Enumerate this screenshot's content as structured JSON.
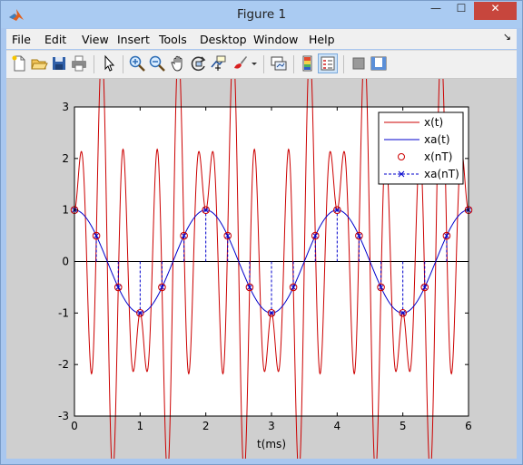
{
  "window": {
    "title": "Figure 1",
    "minimize_symbol": "—",
    "maximize_symbol": "☐",
    "close_symbol": "✕"
  },
  "menubar": {
    "items": [
      "File",
      "Edit",
      "View",
      "Insert",
      "Tools",
      "Desktop",
      "Window",
      "Help"
    ],
    "dock_symbol": "↘"
  },
  "toolbar": {
    "buttons": [
      "new-figure-icon",
      "open-file-icon",
      "save-icon",
      "print-icon",
      "edit-plot-arrow-icon",
      "zoom-in-icon",
      "zoom-out-icon",
      "pan-hand-icon",
      "rotate-3d-icon",
      "data-cursor-icon",
      "brush-icon",
      "brush-dropdown-icon",
      "link-plot-icon",
      "insert-colorbar-icon",
      "insert-legend-icon",
      "hide-plot-tools-icon",
      "show-plot-tools-icon"
    ]
  },
  "chart_data": {
    "type": "line",
    "title": "",
    "xlabel": "t(ms)",
    "ylabel": "",
    "xlim": [
      0,
      6
    ],
    "ylim": [
      -3,
      3
    ],
    "xticks": [
      0,
      1,
      2,
      3,
      4,
      5,
      6
    ],
    "yticks": [
      -3,
      -2,
      -1,
      0,
      1,
      2,
      3
    ],
    "grid": false,
    "legend_position": "top-right",
    "series": [
      {
        "name": "x(t)",
        "color": "#cc0000",
        "style": "solid",
        "formula": "cos(2*pi*0.5*t) + 2*cos(2*pi*2.5*t) - 2*cos(2*pi*3.5*t)"
      },
      {
        "name": "xa(t)",
        "color": "#0000cc",
        "style": "solid",
        "formula": "cos(2*pi*0.5*t)"
      },
      {
        "name": "x(nT)",
        "color": "#cc0000",
        "style": "circle-markers",
        "x": [
          0,
          0.333,
          0.667,
          1,
          1.333,
          1.667,
          2,
          2.333,
          2.667,
          3,
          3.333,
          3.667,
          4,
          4.333,
          4.667,
          5,
          5.333,
          5.667,
          6
        ],
        "y": [
          1,
          0.5,
          -0.5,
          -1,
          -0.5,
          0.5,
          1,
          0.5,
          -0.5,
          -1,
          -0.5,
          0.5,
          1,
          0.5,
          -0.5,
          -1,
          -0.5,
          0.5,
          1
        ]
      },
      {
        "name": "xa(nT)",
        "color": "#0000cc",
        "style": "dashed-stem-x-markers",
        "x": [
          0,
          0.333,
          0.667,
          1,
          1.333,
          1.667,
          2,
          2.333,
          2.667,
          3,
          3.333,
          3.667,
          4,
          4.333,
          4.667,
          5,
          5.333,
          5.667,
          6
        ],
        "y": [
          1,
          0.5,
          -0.5,
          -1,
          -0.5,
          0.5,
          1,
          0.5,
          -0.5,
          -1,
          -0.5,
          0.5,
          1,
          0.5,
          -0.5,
          -1,
          -0.5,
          0.5,
          1
        ]
      }
    ]
  }
}
